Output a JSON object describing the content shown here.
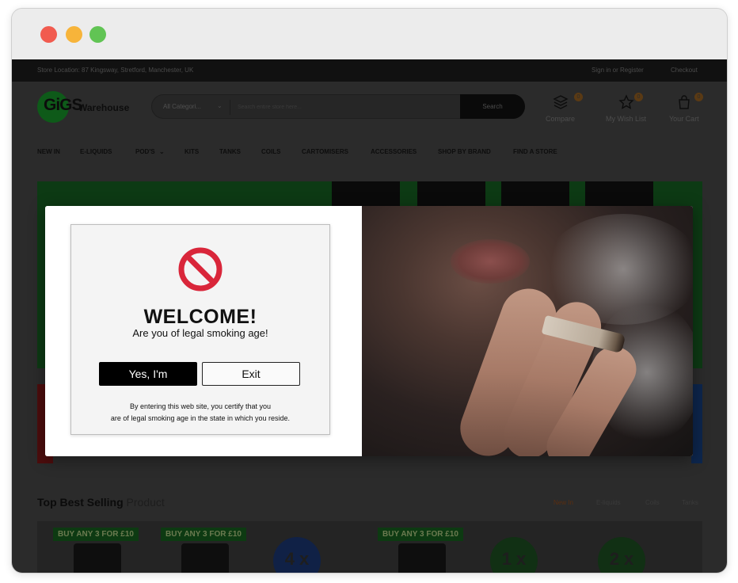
{
  "window": {
    "controls": [
      "close",
      "minimize",
      "maximize"
    ]
  },
  "topbar": {
    "location": "Store Location: 87 Kingsway, Stretford, Manchester, UK",
    "signin": "Sign in or Register",
    "checkout": "Checkout"
  },
  "header": {
    "logo_mark": "GiGS",
    "logo_word": "Warehouse",
    "search": {
      "category": "All Categori...",
      "placeholder": "Search entire store here...",
      "button": "Search"
    },
    "icons": [
      {
        "name": "compare",
        "label": "Compare",
        "badge": "0"
      },
      {
        "name": "wishlist",
        "label": "My Wish List",
        "badge": "0"
      },
      {
        "name": "cart",
        "label": "Your Cart",
        "badge": "0"
      }
    ]
  },
  "nav": {
    "items": [
      "NEW IN",
      "E-LIQUIDS",
      "POD'S",
      "KITS",
      "TANKS",
      "COILS",
      "CARTOMISERS",
      "ACCESSORIES",
      "SHOP BY BRAND",
      "FIND A STORE"
    ]
  },
  "section": {
    "title_bold": "Top Best Selling",
    "title_rest": "Product",
    "tabs": [
      "New In",
      "E-liquids",
      "Coils",
      "Tanks"
    ]
  },
  "products": {
    "promo": "BUY ANY 3 FOR £10",
    "badges": [
      "4 x",
      "1 x",
      "2 x"
    ]
  },
  "modal": {
    "title": "WELCOME!",
    "question": "Are you of legal smoking age!",
    "yes_label": "Yes, I'm",
    "exit_label": "Exit",
    "disclaimer_line1": "By entering this web site, you certify that you",
    "disclaimer_line2": "are of legal smoking age in the state in which you reside.",
    "icon": "no-entry-icon",
    "accent": "#d9263a"
  },
  "colors": {
    "dim_overlay": "#2b2b2b",
    "button_dark": "#000000"
  }
}
